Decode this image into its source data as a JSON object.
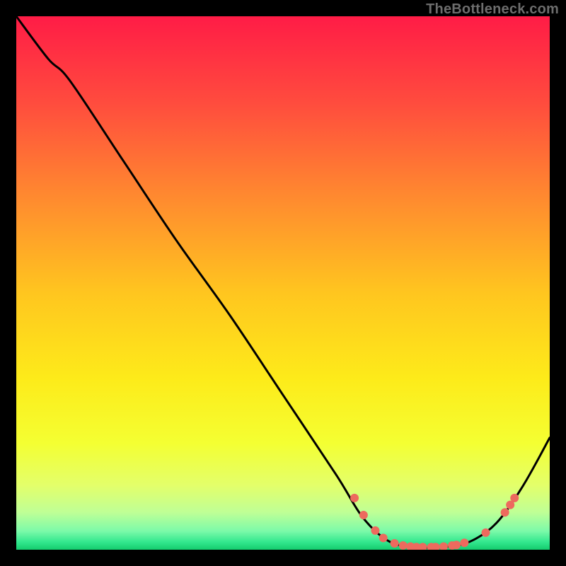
{
  "attribution": "TheBottleneck.com",
  "chart_data": {
    "type": "line",
    "title": "",
    "xlabel": "",
    "ylabel": "",
    "xlim": [
      0,
      100
    ],
    "ylim": [
      0,
      100
    ],
    "curve": {
      "name": "bottleneck-curve",
      "points": [
        {
          "x": 0,
          "y": 100
        },
        {
          "x": 6,
          "y": 92
        },
        {
          "x": 10,
          "y": 88
        },
        {
          "x": 20,
          "y": 73
        },
        {
          "x": 30,
          "y": 58
        },
        {
          "x": 40,
          "y": 44
        },
        {
          "x": 50,
          "y": 29
        },
        {
          "x": 60,
          "y": 14
        },
        {
          "x": 65,
          "y": 6
        },
        {
          "x": 70,
          "y": 1.5
        },
        {
          "x": 75,
          "y": 0.5
        },
        {
          "x": 80,
          "y": 0.5
        },
        {
          "x": 85,
          "y": 1.5
        },
        {
          "x": 90,
          "y": 5
        },
        {
          "x": 95,
          "y": 12
        },
        {
          "x": 100,
          "y": 21
        }
      ]
    },
    "markers": {
      "name": "highlighted-points",
      "color": "#ED6A5E",
      "radius": 6,
      "points": [
        {
          "x": 63.4,
          "y": 9.7
        },
        {
          "x": 65.1,
          "y": 6.5
        },
        {
          "x": 67.3,
          "y": 3.6
        },
        {
          "x": 68.8,
          "y": 2.2
        },
        {
          "x": 70.9,
          "y": 1.2
        },
        {
          "x": 72.5,
          "y": 0.8
        },
        {
          "x": 73.9,
          "y": 0.6
        },
        {
          "x": 75.0,
          "y": 0.5
        },
        {
          "x": 76.2,
          "y": 0.5
        },
        {
          "x": 77.8,
          "y": 0.5
        },
        {
          "x": 78.6,
          "y": 0.5
        },
        {
          "x": 80.1,
          "y": 0.6
        },
        {
          "x": 81.7,
          "y": 0.8
        },
        {
          "x": 82.5,
          "y": 0.9
        },
        {
          "x": 84.0,
          "y": 1.3
        },
        {
          "x": 88.0,
          "y": 3.2
        },
        {
          "x": 91.6,
          "y": 7.0
        },
        {
          "x": 92.6,
          "y": 8.4
        },
        {
          "x": 93.4,
          "y": 9.7
        }
      ]
    },
    "background_gradient": {
      "stops": [
        {
          "offset": 0.0,
          "color": "#FF1C46"
        },
        {
          "offset": 0.16,
          "color": "#FF4B3E"
        },
        {
          "offset": 0.34,
          "color": "#FF8A2F"
        },
        {
          "offset": 0.52,
          "color": "#FFC61F"
        },
        {
          "offset": 0.68,
          "color": "#FDEB1A"
        },
        {
          "offset": 0.8,
          "color": "#F4FF32"
        },
        {
          "offset": 0.88,
          "color": "#E3FF6B"
        },
        {
          "offset": 0.93,
          "color": "#BFFF96"
        },
        {
          "offset": 0.965,
          "color": "#7CFAA9"
        },
        {
          "offset": 0.985,
          "color": "#34E88F"
        },
        {
          "offset": 1.0,
          "color": "#14CC6E"
        }
      ]
    }
  }
}
